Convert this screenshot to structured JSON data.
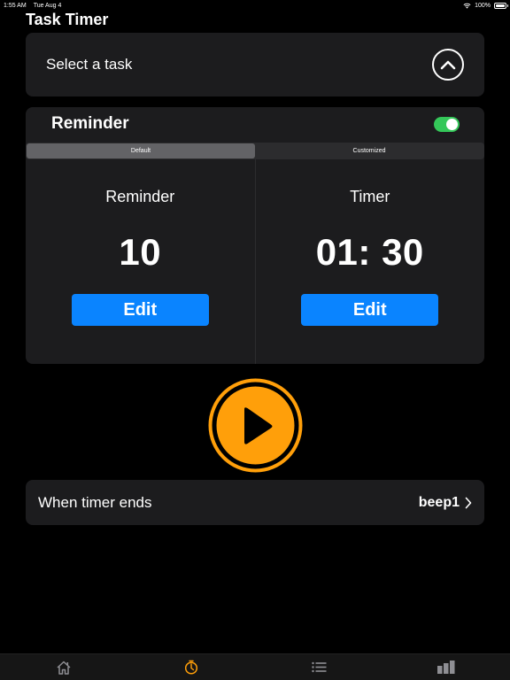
{
  "status_bar": {
    "time": "1:55 AM",
    "date": "Tue Aug 4",
    "battery": "100%"
  },
  "page_title": "Task Timer",
  "task_select": {
    "label": "Select a task",
    "icon": "chevron-up-circle-icon"
  },
  "reminder": {
    "label": "Reminder",
    "enabled": true,
    "segments": [
      {
        "label": "Default",
        "selected": true
      },
      {
        "label": "Customized",
        "selected": false
      }
    ],
    "reminder_panel": {
      "title": "Reminder",
      "value": "10",
      "edit_label": "Edit"
    },
    "timer_panel": {
      "title": "Timer",
      "value": "01: 30",
      "edit_label": "Edit"
    }
  },
  "play_button": {
    "icon": "play-icon",
    "color": "#ff9f0a"
  },
  "timer_end": {
    "label": "When timer ends",
    "value": "beep1"
  },
  "tab_bar": {
    "tabs": [
      {
        "name": "home",
        "icon": "home-icon",
        "active": false
      },
      {
        "name": "timer",
        "icon": "timer-icon",
        "active": true
      },
      {
        "name": "list",
        "icon": "list-icon",
        "active": false
      },
      {
        "name": "stats",
        "icon": "bar-chart-icon",
        "active": false
      }
    ],
    "active_color": "#ff9f0a",
    "inactive_color": "#8e8e93"
  },
  "colors": {
    "accent_blue": "#0a84ff",
    "toggle_green": "#34c759",
    "card_bg": "#1c1c1e"
  }
}
